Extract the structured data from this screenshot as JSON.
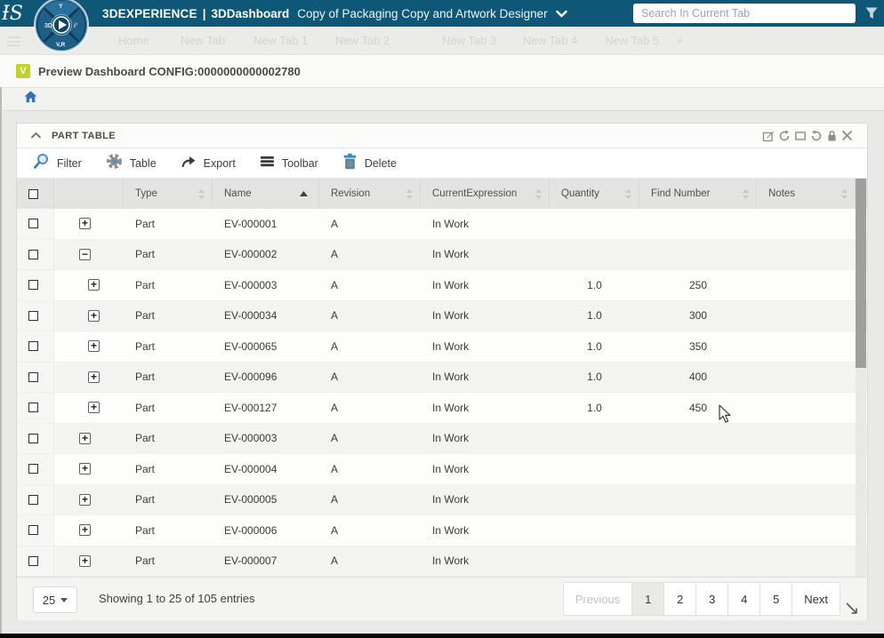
{
  "app": {
    "brand": "3DEXPERIENCE",
    "separator": "|",
    "product": "3DDashboard",
    "dashboard_title": "Copy of Packaging Copy and Artwork Designer",
    "search_placeholder": "Search In Current Tab",
    "compass_labels": {
      "left": "3D",
      "right": "i’",
      "bottom": "V,R",
      "top": "Y"
    }
  },
  "tabs": {
    "items": [
      {
        "label": "Home"
      },
      {
        "label": "New Tab"
      },
      {
        "label": "New Tab 1"
      },
      {
        "label": "New Tab 2"
      },
      {
        "label": "New Tab 3"
      },
      {
        "label": "New Tab 4"
      },
      {
        "label": "New Tab 5"
      },
      {
        "label": "+"
      }
    ]
  },
  "preview_bar": {
    "badge": "V",
    "label": "Preview Dashboard CONFIG:0000000000002780"
  },
  "widget": {
    "title": "PART TABLE",
    "header_icons": [
      "edit",
      "refresh",
      "maximize",
      "undo",
      "lock",
      "close"
    ],
    "toolbar": {
      "items": [
        {
          "icon": "filter-icon",
          "label": "Filter"
        },
        {
          "icon": "gear-icon",
          "label": "Table"
        },
        {
          "icon": "export-icon",
          "label": "Export"
        },
        {
          "icon": "toolbar-icon",
          "label": "Toolbar"
        },
        {
          "icon": "delete-icon",
          "label": "Delete"
        }
      ]
    },
    "table": {
      "columns": [
        "Type",
        "Name",
        "Revision",
        "CurrentExpression",
        "Quantity",
        "Find Number",
        "Notes"
      ],
      "sorted_column": "Name",
      "sort_direction": "ascending",
      "rows": [
        {
          "expand_symbol": "+",
          "expand_state": "collapsed",
          "child": false,
          "type": "Part",
          "name": "EV-000001",
          "revision": "A",
          "current_expression": "In Work",
          "quantity": "",
          "find_number": "",
          "notes": ""
        },
        {
          "expand_symbol": "−",
          "expand_state": "expanded",
          "child": false,
          "type": "Part",
          "name": "EV-000002",
          "revision": "A",
          "current_expression": "In Work",
          "quantity": "",
          "find_number": "",
          "notes": ""
        },
        {
          "expand_symbol": "+",
          "expand_state": "collapsed",
          "child": true,
          "type": "Part",
          "name": "EV-000003",
          "revision": "A",
          "current_expression": "In Work",
          "quantity": "1.0",
          "find_number": "250",
          "notes": ""
        },
        {
          "expand_symbol": "+",
          "expand_state": "collapsed",
          "child": true,
          "type": "Part",
          "name": "EV-000034",
          "revision": "A",
          "current_expression": "In Work",
          "quantity": "1.0",
          "find_number": "300",
          "notes": ""
        },
        {
          "expand_symbol": "+",
          "expand_state": "collapsed",
          "child": true,
          "type": "Part",
          "name": "EV-000065",
          "revision": "A",
          "current_expression": "In Work",
          "quantity": "1.0",
          "find_number": "350",
          "notes": ""
        },
        {
          "expand_symbol": "+",
          "expand_state": "collapsed",
          "child": true,
          "type": "Part",
          "name": "EV-000096",
          "revision": "A",
          "current_expression": "In Work",
          "quantity": "1.0",
          "find_number": "400",
          "notes": ""
        },
        {
          "expand_symbol": "+",
          "expand_state": "collapsed",
          "child": true,
          "type": "Part",
          "name": "EV-000127",
          "revision": "A",
          "current_expression": "In Work",
          "quantity": "1.0",
          "find_number": "450",
          "notes": ""
        },
        {
          "expand_symbol": "+",
          "expand_state": "collapsed",
          "child": false,
          "type": "Part",
          "name": "EV-000003",
          "revision": "A",
          "current_expression": "In Work",
          "quantity": "",
          "find_number": "",
          "notes": ""
        },
        {
          "expand_symbol": "+",
          "expand_state": "collapsed",
          "child": false,
          "type": "Part",
          "name": "EV-000004",
          "revision": "A",
          "current_expression": "In Work",
          "quantity": "",
          "find_number": "",
          "notes": ""
        },
        {
          "expand_symbol": "+",
          "expand_state": "collapsed",
          "child": false,
          "type": "Part",
          "name": "EV-000005",
          "revision": "A",
          "current_expression": "In Work",
          "quantity": "",
          "find_number": "",
          "notes": ""
        },
        {
          "expand_symbol": "+",
          "expand_state": "collapsed",
          "child": false,
          "type": "Part",
          "name": "EV-000006",
          "revision": "A",
          "current_expression": "In Work",
          "quantity": "",
          "find_number": "",
          "notes": ""
        },
        {
          "expand_symbol": "+",
          "expand_state": "collapsed",
          "child": false,
          "type": "Part",
          "name": "EV-000007",
          "revision": "A",
          "current_expression": "In Work",
          "quantity": "",
          "find_number": "",
          "notes": ""
        }
      ]
    },
    "footer": {
      "page_size": "25",
      "showing_text": "Showing 1 to 25 of 105 entries",
      "pagination": {
        "previous": "Previous",
        "pages": [
          "1",
          "2",
          "3",
          "4",
          "5"
        ],
        "active_page": "1",
        "next": "Next"
      }
    }
  },
  "colors": {
    "topbar_blue": "#0f5777",
    "badge_lime": "#c2d22c",
    "home_icon_blue": "#3a6cae",
    "filter_icon_blue": "#4a90c2",
    "trash_lid_blue": "#2e8fc5",
    "scroll_thumb": "#9e9e9c",
    "header_gray": "#e3e3e1",
    "row_alt": "#f3f3f1"
  }
}
